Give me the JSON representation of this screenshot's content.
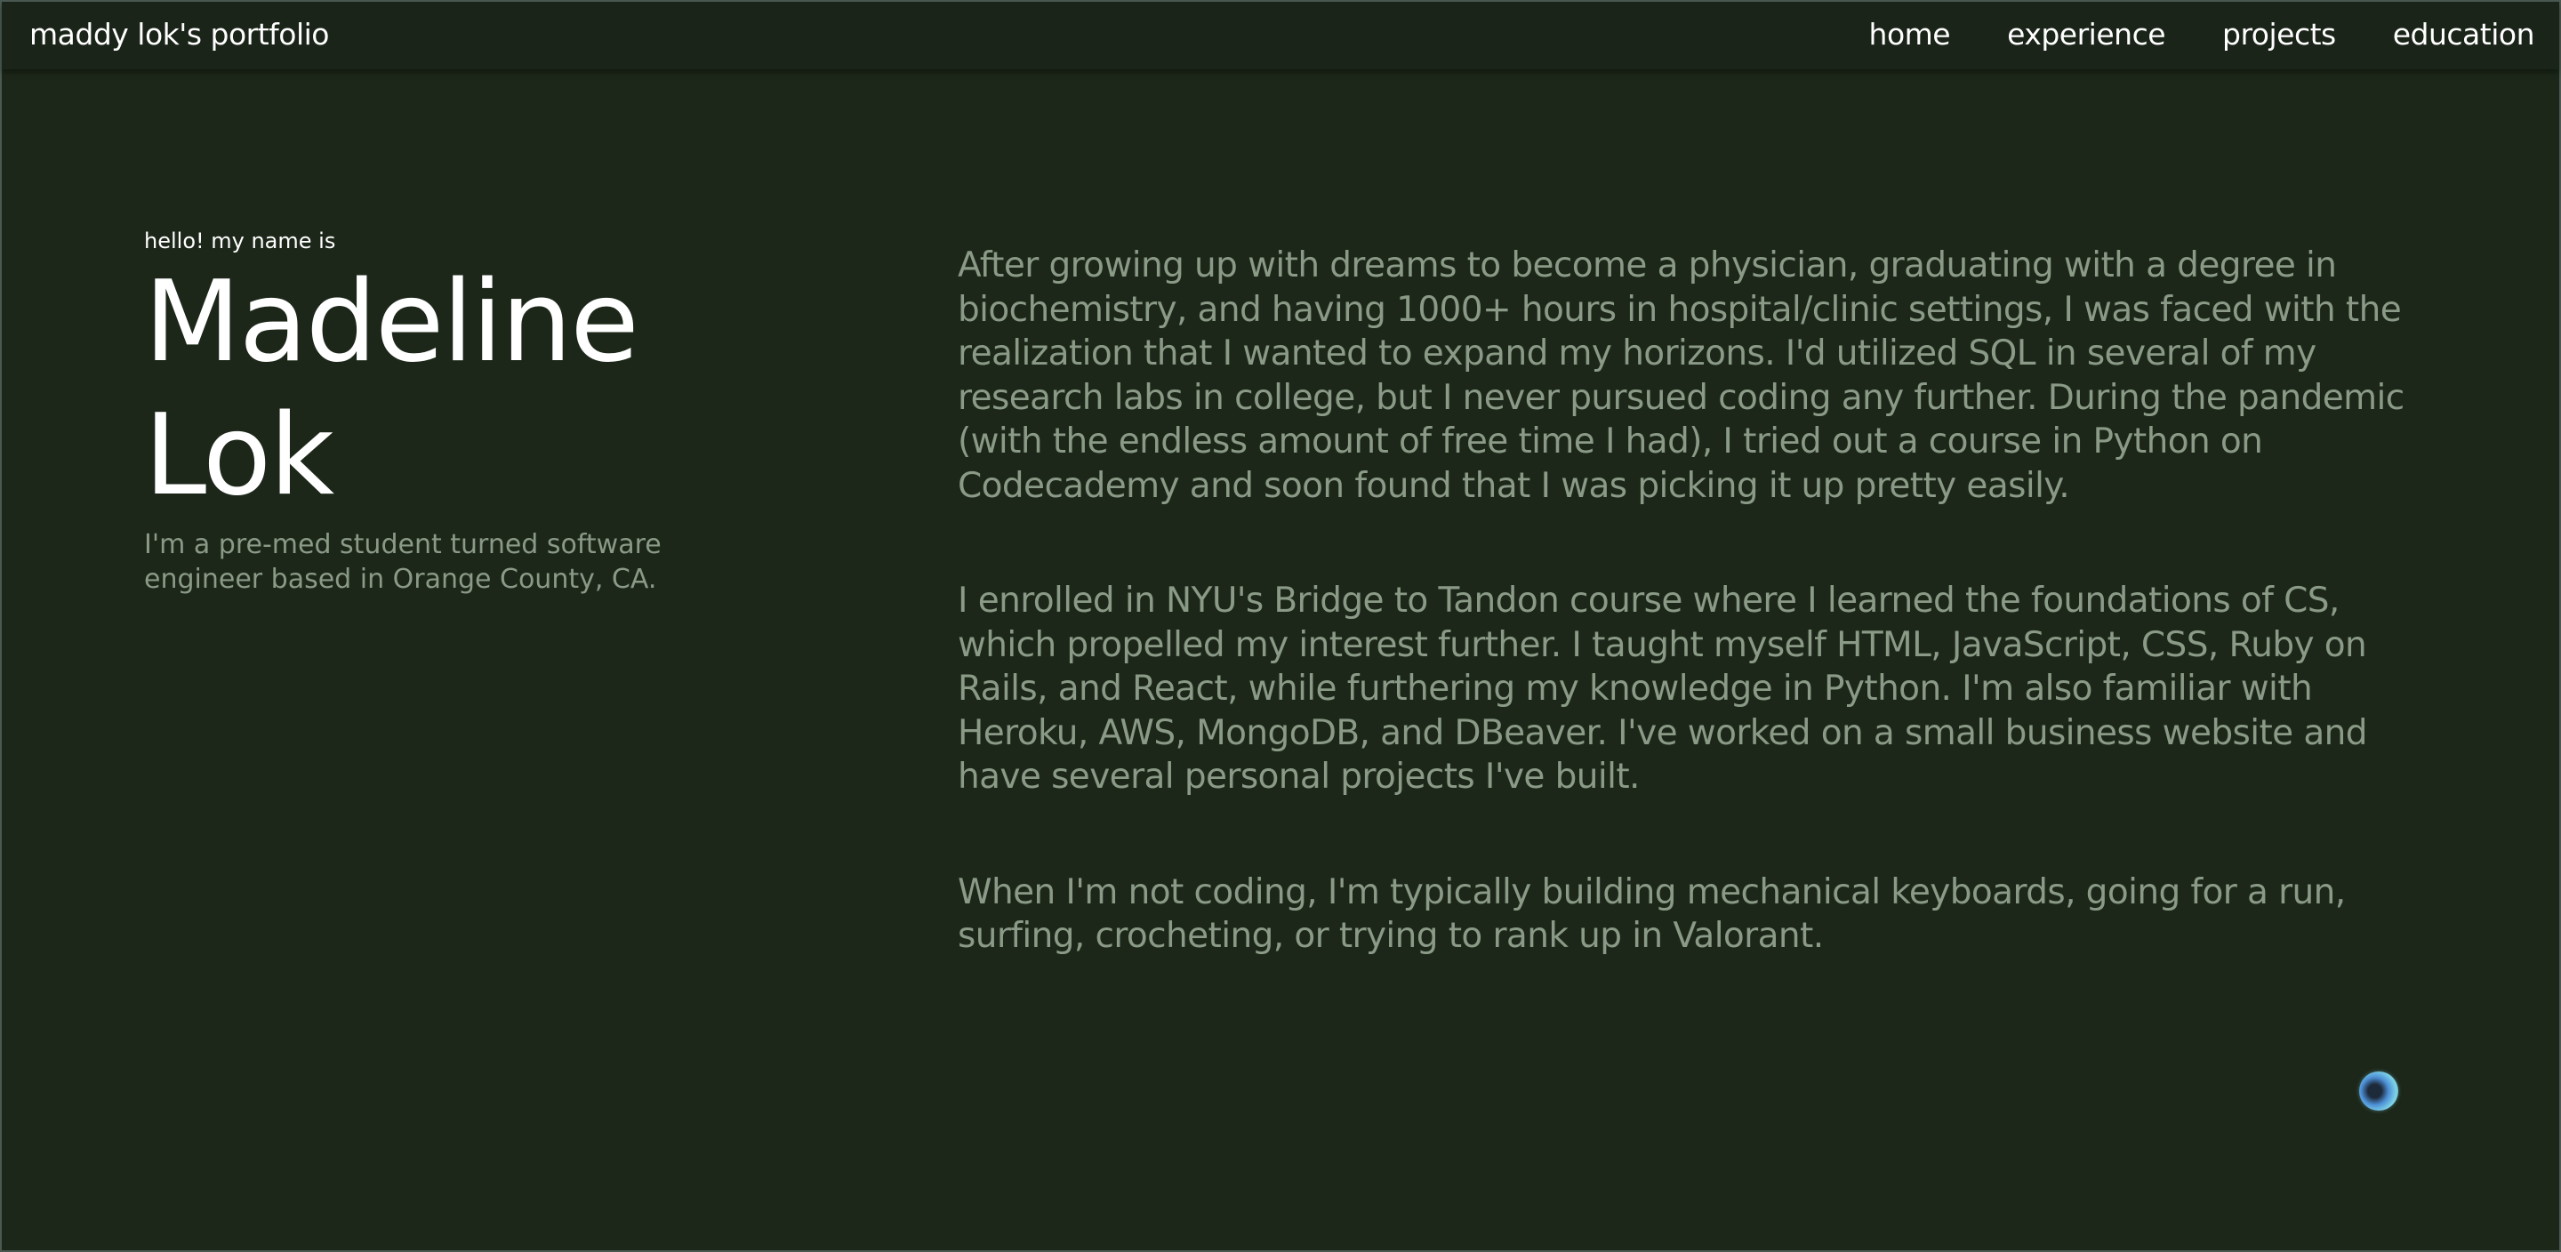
{
  "navbar": {
    "brand": "maddy lok's portfolio",
    "links": [
      "home",
      "experience",
      "projects",
      "education"
    ]
  },
  "intro": {
    "greeting": "hello! my name is",
    "first_name": "Madeline",
    "last_name": "Lok",
    "tagline": "I'm a pre-med student turned software engineer based in Orange County, CA."
  },
  "about": {
    "paragraphs": [
      "After growing up with dreams to become a physician, graduating with a degree in biochemistry, and having 1000+ hours in hospital/clinic settings, I was faced with the realization that I wanted to expand my horizons. I'd utilized SQL in several of my research labs in college, but I never pursued coding any further. During the pandemic (with the endless amount of free time I had), I tried out a course in Python on Codecademy and soon found that I was picking it up pretty easily.",
      "I enrolled in NYU's Bridge to Tandon course where I learned the foundations of CS, which propelled my interest further. I taught myself HTML, JavaScript, CSS, Ruby on Rails, and React, while furthering my knowledge in Python. I'm also familiar with Heroku, AWS, MongoDB, and DBeaver. I've worked on a small business website and have several personal projects I've built.",
      "When I'm not coding, I'm typically building mechanical keyboards, going for a run, surfing, crocheting, or trying to rank up in Valorant."
    ]
  },
  "colors": {
    "background": "#1c2719",
    "navbar": "#1a2418",
    "primary_text": "#ffffff",
    "muted_text": "#8a9a87"
  },
  "icons": {
    "floating_orb": "orb-icon"
  }
}
